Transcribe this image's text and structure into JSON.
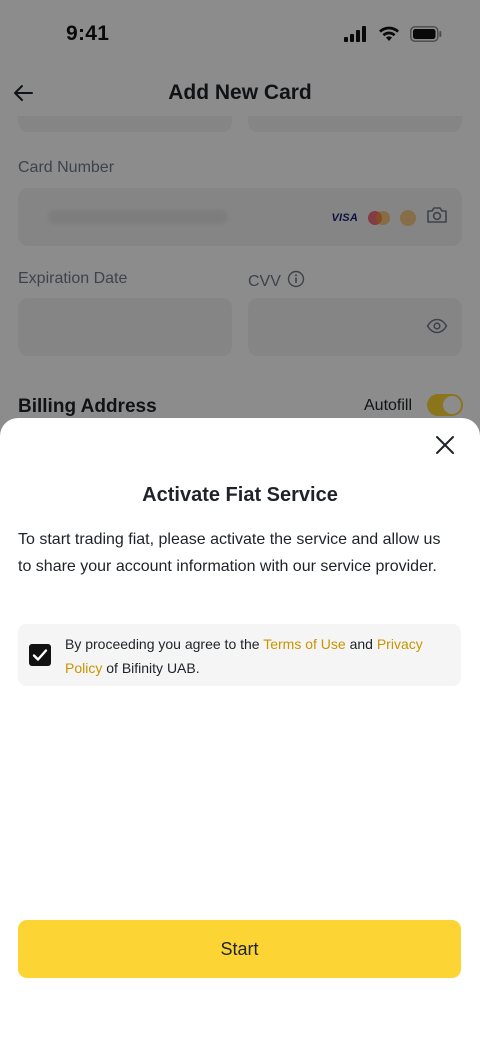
{
  "status_bar": {
    "time": "9:41"
  },
  "header": {
    "title": "Add New Card"
  },
  "form": {
    "card_number_label": "Card Number",
    "card_brands": {
      "visa": "VISA"
    },
    "expiration_label": "Expiration Date",
    "cvv_label": "CVV",
    "billing_title": "Billing Address",
    "autofill_label": "Autofill",
    "autofill_on": true
  },
  "sheet": {
    "title": "Activate Fiat Service",
    "body": "To start trading fiat, please activate the service and allow us to share your account information with our service provider.",
    "consent": {
      "checked": true,
      "prefix": "By proceeding you agree to the ",
      "terms_link": "Terms of Use",
      "middle": " and ",
      "privacy_link": "Privacy Policy",
      "suffix": " of Bifinity UAB."
    },
    "start_label": "Start"
  },
  "colors": {
    "accent": "#fcd535",
    "link": "#c99400",
    "text": "#1e2329",
    "muted": "#707a8a"
  }
}
